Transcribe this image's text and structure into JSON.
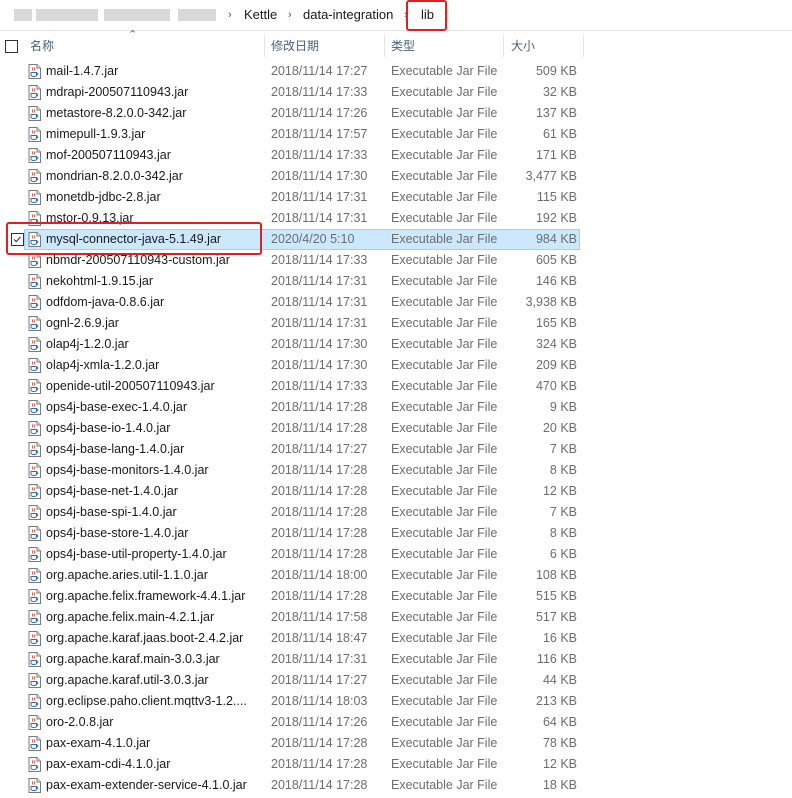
{
  "address": {
    "crumbs": [
      "Kettle",
      "data-integration",
      "lib"
    ],
    "separator": "›"
  },
  "columns": {
    "name": "名称",
    "date": "修改日期",
    "type": "类型",
    "size": "大小"
  },
  "files": [
    {
      "name": "mail-1.4.7.jar",
      "date": "2018/11/14 17:27",
      "type": "Executable Jar File",
      "size": "509 KB"
    },
    {
      "name": "mdrapi-200507110943.jar",
      "date": "2018/11/14 17:33",
      "type": "Executable Jar File",
      "size": "32 KB"
    },
    {
      "name": "metastore-8.2.0.0-342.jar",
      "date": "2018/11/14 17:26",
      "type": "Executable Jar File",
      "size": "137 KB"
    },
    {
      "name": "mimepull-1.9.3.jar",
      "date": "2018/11/14 17:57",
      "type": "Executable Jar File",
      "size": "61 KB"
    },
    {
      "name": "mof-200507110943.jar",
      "date": "2018/11/14 17:33",
      "type": "Executable Jar File",
      "size": "171 KB"
    },
    {
      "name": "mondrian-8.2.0.0-342.jar",
      "date": "2018/11/14 17:30",
      "type": "Executable Jar File",
      "size": "3,477 KB"
    },
    {
      "name": "monetdb-jdbc-2.8.jar",
      "date": "2018/11/14 17:31",
      "type": "Executable Jar File",
      "size": "115 KB"
    },
    {
      "name": "mstor-0.9.13.jar",
      "date": "2018/11/14 17:31",
      "type": "Executable Jar File",
      "size": "192 KB"
    },
    {
      "name": "mysql-connector-java-5.1.49.jar",
      "date": "2020/4/20 5:10",
      "type": "Executable Jar File",
      "size": "984 KB",
      "selected": true
    },
    {
      "name": "nbmdr-200507110943-custom.jar",
      "date": "2018/11/14 17:33",
      "type": "Executable Jar File",
      "size": "605 KB"
    },
    {
      "name": "nekohtml-1.9.15.jar",
      "date": "2018/11/14 17:31",
      "type": "Executable Jar File",
      "size": "146 KB"
    },
    {
      "name": "odfdom-java-0.8.6.jar",
      "date": "2018/11/14 17:31",
      "type": "Executable Jar File",
      "size": "3,938 KB"
    },
    {
      "name": "ognl-2.6.9.jar",
      "date": "2018/11/14 17:31",
      "type": "Executable Jar File",
      "size": "165 KB"
    },
    {
      "name": "olap4j-1.2.0.jar",
      "date": "2018/11/14 17:30",
      "type": "Executable Jar File",
      "size": "324 KB"
    },
    {
      "name": "olap4j-xmla-1.2.0.jar",
      "date": "2018/11/14 17:30",
      "type": "Executable Jar File",
      "size": "209 KB"
    },
    {
      "name": "openide-util-200507110943.jar",
      "date": "2018/11/14 17:33",
      "type": "Executable Jar File",
      "size": "470 KB"
    },
    {
      "name": "ops4j-base-exec-1.4.0.jar",
      "date": "2018/11/14 17:28",
      "type": "Executable Jar File",
      "size": "9 KB"
    },
    {
      "name": "ops4j-base-io-1.4.0.jar",
      "date": "2018/11/14 17:28",
      "type": "Executable Jar File",
      "size": "20 KB"
    },
    {
      "name": "ops4j-base-lang-1.4.0.jar",
      "date": "2018/11/14 17:27",
      "type": "Executable Jar File",
      "size": "7 KB"
    },
    {
      "name": "ops4j-base-monitors-1.4.0.jar",
      "date": "2018/11/14 17:28",
      "type": "Executable Jar File",
      "size": "8 KB"
    },
    {
      "name": "ops4j-base-net-1.4.0.jar",
      "date": "2018/11/14 17:28",
      "type": "Executable Jar File",
      "size": "12 KB"
    },
    {
      "name": "ops4j-base-spi-1.4.0.jar",
      "date": "2018/11/14 17:28",
      "type": "Executable Jar File",
      "size": "7 KB"
    },
    {
      "name": "ops4j-base-store-1.4.0.jar",
      "date": "2018/11/14 17:28",
      "type": "Executable Jar File",
      "size": "8 KB"
    },
    {
      "name": "ops4j-base-util-property-1.4.0.jar",
      "date": "2018/11/14 17:28",
      "type": "Executable Jar File",
      "size": "6 KB"
    },
    {
      "name": "org.apache.aries.util-1.1.0.jar",
      "date": "2018/11/14 18:00",
      "type": "Executable Jar File",
      "size": "108 KB"
    },
    {
      "name": "org.apache.felix.framework-4.4.1.jar",
      "date": "2018/11/14 17:28",
      "type": "Executable Jar File",
      "size": "515 KB"
    },
    {
      "name": "org.apache.felix.main-4.2.1.jar",
      "date": "2018/11/14 17:58",
      "type": "Executable Jar File",
      "size": "517 KB"
    },
    {
      "name": "org.apache.karaf.jaas.boot-2.4.2.jar",
      "date": "2018/11/14 18:47",
      "type": "Executable Jar File",
      "size": "16 KB"
    },
    {
      "name": "org.apache.karaf.main-3.0.3.jar",
      "date": "2018/11/14 17:31",
      "type": "Executable Jar File",
      "size": "116 KB"
    },
    {
      "name": "org.apache.karaf.util-3.0.3.jar",
      "date": "2018/11/14 17:27",
      "type": "Executable Jar File",
      "size": "44 KB"
    },
    {
      "name": "org.eclipse.paho.client.mqttv3-1.2....",
      "date": "2018/11/14 18:03",
      "type": "Executable Jar File",
      "size": "213 KB"
    },
    {
      "name": "oro-2.0.8.jar",
      "date": "2018/11/14 17:26",
      "type": "Executable Jar File",
      "size": "64 KB"
    },
    {
      "name": "pax-exam-4.1.0.jar",
      "date": "2018/11/14 17:28",
      "type": "Executable Jar File",
      "size": "78 KB"
    },
    {
      "name": "pax-exam-cdi-4.1.0.jar",
      "date": "2018/11/14 17:28",
      "type": "Executable Jar File",
      "size": "12 KB"
    },
    {
      "name": "pax-exam-extender-service-4.1.0.jar",
      "date": "2018/11/14 17:28",
      "type": "Executable Jar File",
      "size": "18 KB"
    }
  ],
  "colors": {
    "highlight_box": "#e02020",
    "selection_bg": "#cce8ff",
    "header_text": "#4c607a"
  },
  "icons": {
    "file": "jar-file-icon",
    "sort": "sort-up-arrow-icon"
  }
}
